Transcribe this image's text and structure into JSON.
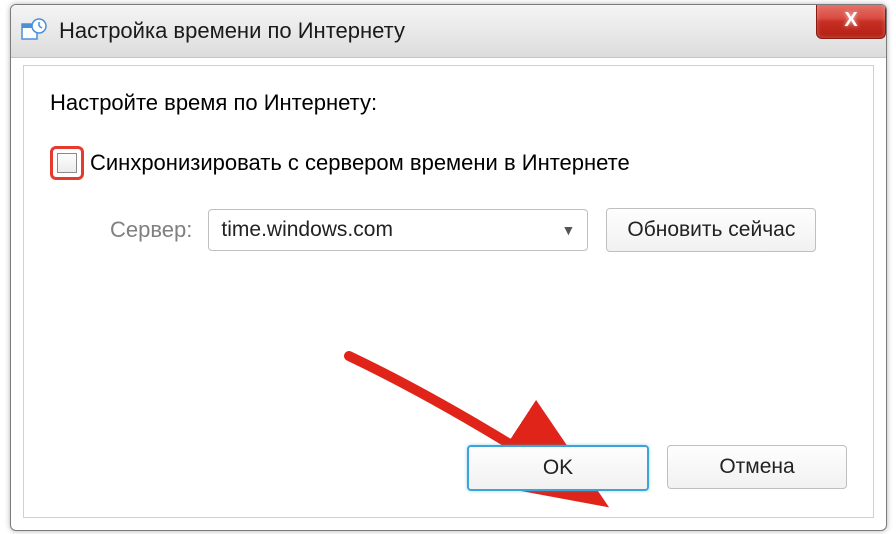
{
  "titlebar": {
    "title": "Настройка времени по Интернету",
    "close_label": "X"
  },
  "content": {
    "instruction": "Настройте время по Интернету:",
    "sync_label": "Синхронизировать с сервером времени в Интернете",
    "sync_checked": false,
    "server_label": "Сервер:",
    "server_value": "time.windows.com",
    "update_label": "Обновить сейчас"
  },
  "buttons": {
    "ok": "OK",
    "cancel": "Отмена"
  },
  "annotation": {
    "checkbox_highlight_color": "#e63a2e",
    "arrow_color": "#e0241a"
  }
}
